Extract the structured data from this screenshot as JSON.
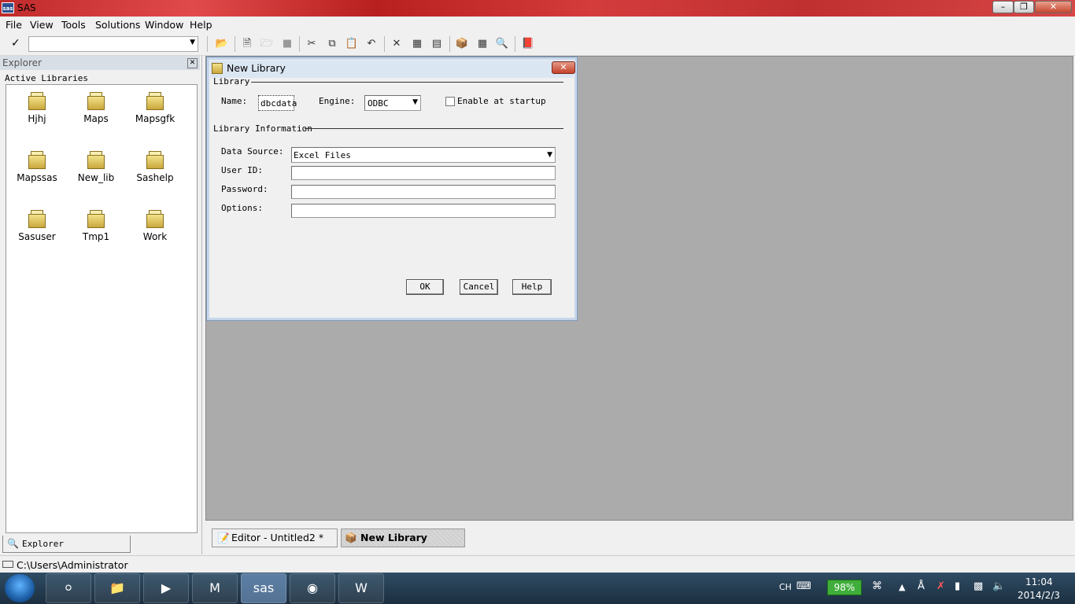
{
  "app": {
    "title": "SAS",
    "icon_text": "sas"
  },
  "menu": [
    "File",
    "View",
    "Tools",
    "Solutions",
    "Window",
    "Help"
  ],
  "explorer": {
    "title": "Explorer",
    "subtitle": "Active Libraries",
    "libraries": [
      "Hjhj",
      "Maps",
      "Mapsgfk",
      "Mapssas",
      "New_lib",
      "Sashelp",
      "Sasuser",
      "Tmp1",
      "Work"
    ],
    "tab_label": "Explorer"
  },
  "dialog": {
    "title": "New Library",
    "library_group": "Library",
    "name_label": "Name:",
    "name_value": "dbcdata",
    "engine_label": "Engine:",
    "engine_value": "ODBC",
    "enable_label": "Enable at startup",
    "info_group": "Library Information",
    "data_source_label": "Data Source:",
    "data_source_value": "Excel Files",
    "user_id_label": "User ID:",
    "password_label": "Password:",
    "options_label": "Options:",
    "ok_label": "OK",
    "cancel_label": "Cancel",
    "help_label": "Help"
  },
  "window_tabs": [
    "Editor - Untitled2 *",
    "New Library"
  ],
  "status": {
    "path": "C:\\Users\\Administrator"
  },
  "taskbar": {
    "battery": "98%",
    "lang": "CH",
    "time": "11:04",
    "date": "2014/2/3"
  }
}
